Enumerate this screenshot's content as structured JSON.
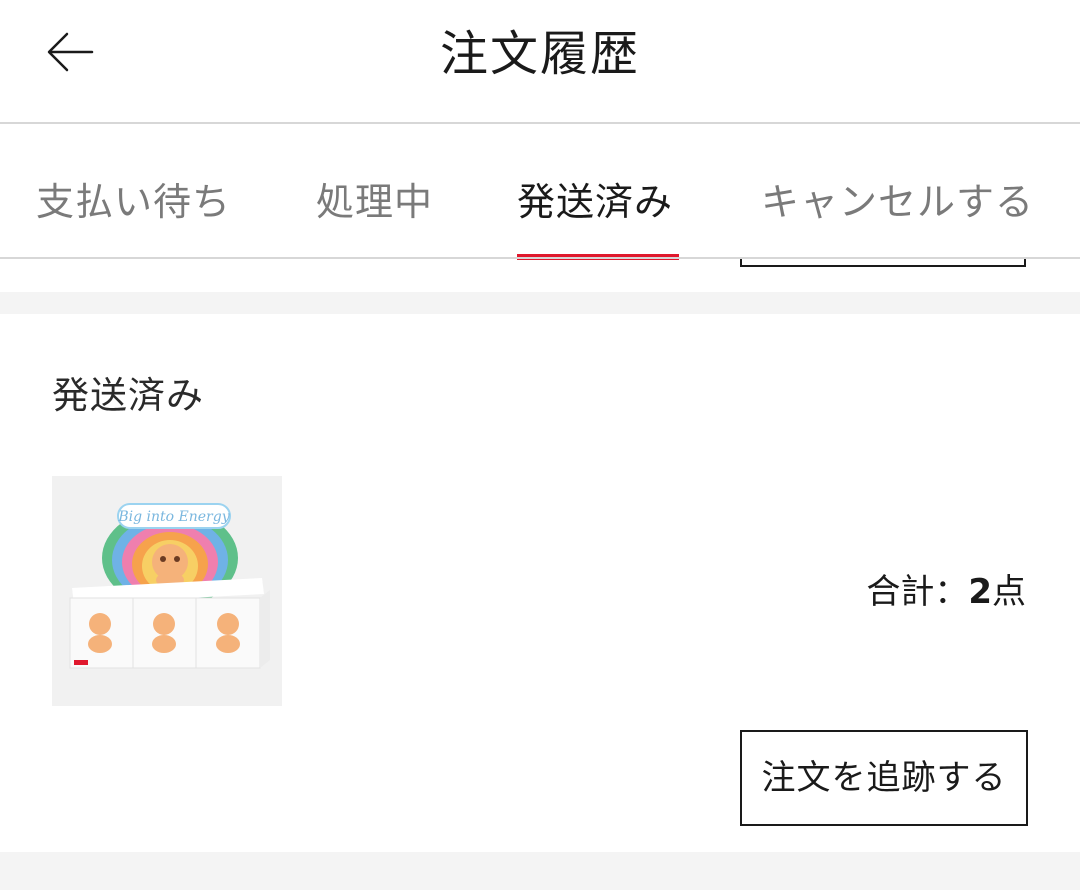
{
  "header": {
    "back_icon": "arrow-left-icon",
    "title": "注文履歴"
  },
  "tabs": [
    {
      "label": "支払い待ち",
      "active": false
    },
    {
      "label": "処理中",
      "active": false
    },
    {
      "label": "発送済み",
      "active": true
    },
    {
      "label": "キャンセルする",
      "active": false
    }
  ],
  "colors": {
    "accent": "#e0182d",
    "divider": "#d7d7d7",
    "background_band": "#f4f4f4"
  },
  "order": {
    "status": "発送済み",
    "product_image": {
      "logo_text": "Big into Energy"
    },
    "total_label": "合計：",
    "total_count": "2",
    "total_unit": "点",
    "track_button": "注文を追跡する"
  }
}
